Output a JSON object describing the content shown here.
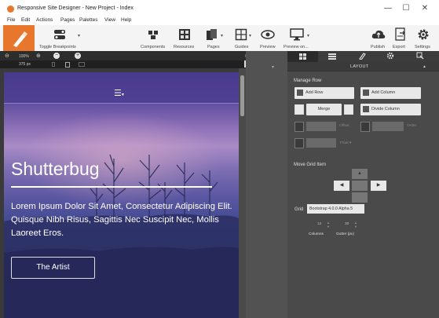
{
  "window": {
    "title": "Responsive Site Designer - New Project - Index",
    "minimize": "—",
    "maximize": "☐",
    "close": "✕"
  },
  "menu": {
    "items": [
      "File",
      "Edit",
      "Actions",
      "Pages",
      "Palettes",
      "View",
      "Help"
    ]
  },
  "toolbar": {
    "toggle_breakpoints": "Toggle Breakpoints",
    "components": "Components",
    "resources": "Resources",
    "pages": "Pages",
    "guides": "Guides",
    "preview": "Preview",
    "preview_on": "Preview on...",
    "publish": "Publish",
    "export": "Export",
    "settings": "Settings"
  },
  "canvas": {
    "zoom": "100%",
    "width": "375 px"
  },
  "preview": {
    "title": "Shutterbug",
    "body": "Lorem Ipsum Dolor Sit Amet, Consectetur Adipiscing Elit. Quisque Nibh Risus, Sagittis Nec Suscipit Nec, Mollis Laoreet Eros.",
    "button": "The Artist"
  },
  "panel": {
    "section": "LAYOUT",
    "manage_row": "Manage Row",
    "add_row": "Add Row",
    "add_column": "Add Column",
    "merge": "Merge",
    "divide_column": "Divide Column",
    "offset_label": "Offset",
    "order_label": "Order",
    "float_label": "Float",
    "float_value": "Float ▾",
    "move_grid_item": "Move Grid Item",
    "grid_label": "Grid",
    "grid_value": "Bootstrap 4.0.0 Alpha 5",
    "columns_value": "12",
    "columns_label": "Columns",
    "gutter_value": "30",
    "gutter_label": "Gutter (px)"
  },
  "colors": {
    "accent": "#e8772e",
    "panel_bg": "#4a4a4a",
    "canvas_bg": "#3a3a3a"
  }
}
